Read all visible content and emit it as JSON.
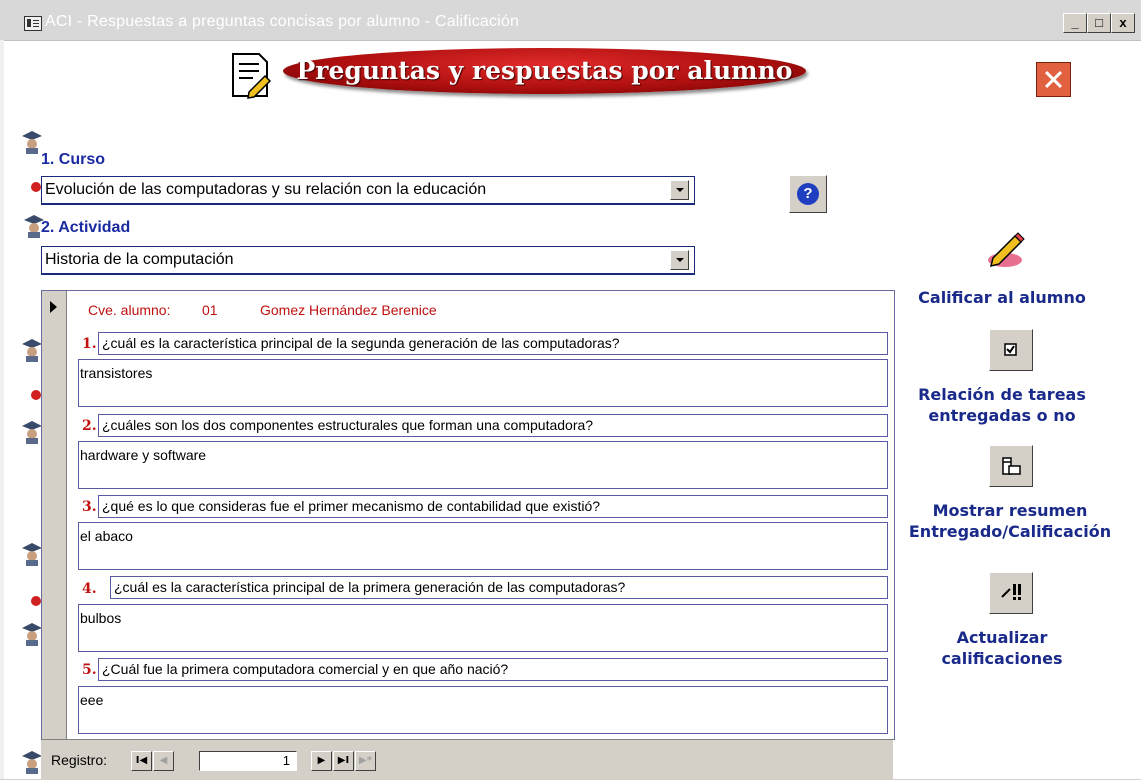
{
  "window": {
    "title": "ACI - Respuestas a preguntas concisas por alumno - Calificación",
    "minimize": "_",
    "maximize": "□",
    "close": "x"
  },
  "header": {
    "title": "Preguntas y respuestas por alumno"
  },
  "curso": {
    "label": "1. Curso",
    "value": "Evolución de las computadoras y su relación con la educación"
  },
  "actividad": {
    "label": "2. Actividad",
    "value": "Historia de la computación"
  },
  "student": {
    "key_label": "Cve. alumno:",
    "key_value": "01",
    "name": "Gomez Hernández Berenice"
  },
  "questions": [
    {
      "num": "1.",
      "question": "¿cuál es la característica principal de la segunda generación de las computadoras?",
      "answer": "transistores"
    },
    {
      "num": "2.",
      "question": "¿cuáles son los dos componentes estructurales que forman una computadora?",
      "answer": "hardware y software"
    },
    {
      "num": "3.",
      "question": "¿qué es lo que consideras fue el primer mecanismo de contabilidad que existió?",
      "answer": "el abaco"
    },
    {
      "num": "4.",
      "question": "¿cuál es la característica principal de la primera generación de las computadoras?",
      "answer": "bulbos"
    },
    {
      "num": "5.",
      "question": "¿Cuál fue la primera computadora comercial y en que año nació?",
      "answer": "eee"
    }
  ],
  "navigation": {
    "label": "Registro:",
    "first": "I◀",
    "prev": "◀",
    "record": "1",
    "next": "▶",
    "last": "▶I",
    "new": "▶*"
  },
  "actions": {
    "calificar": "Calificar al alumno",
    "relacion": "Relación de tareas entregadas o no",
    "mostrar": "Mostrar resumen Entregado/Calificación",
    "actualizar": "Actualizar calificaciones"
  },
  "icons": {
    "help": "question-icon",
    "close": "close-icon",
    "document": "document-pencil-icon",
    "pencil": "pencil-icon",
    "checkbox": "checkbox-icon",
    "summary": "summary-icon",
    "update": "update-icon"
  },
  "colors": {
    "title_banner": "#b01010",
    "section_label": "#1a2aa0",
    "question_number": "#c01010",
    "student_info": "#c01010"
  }
}
